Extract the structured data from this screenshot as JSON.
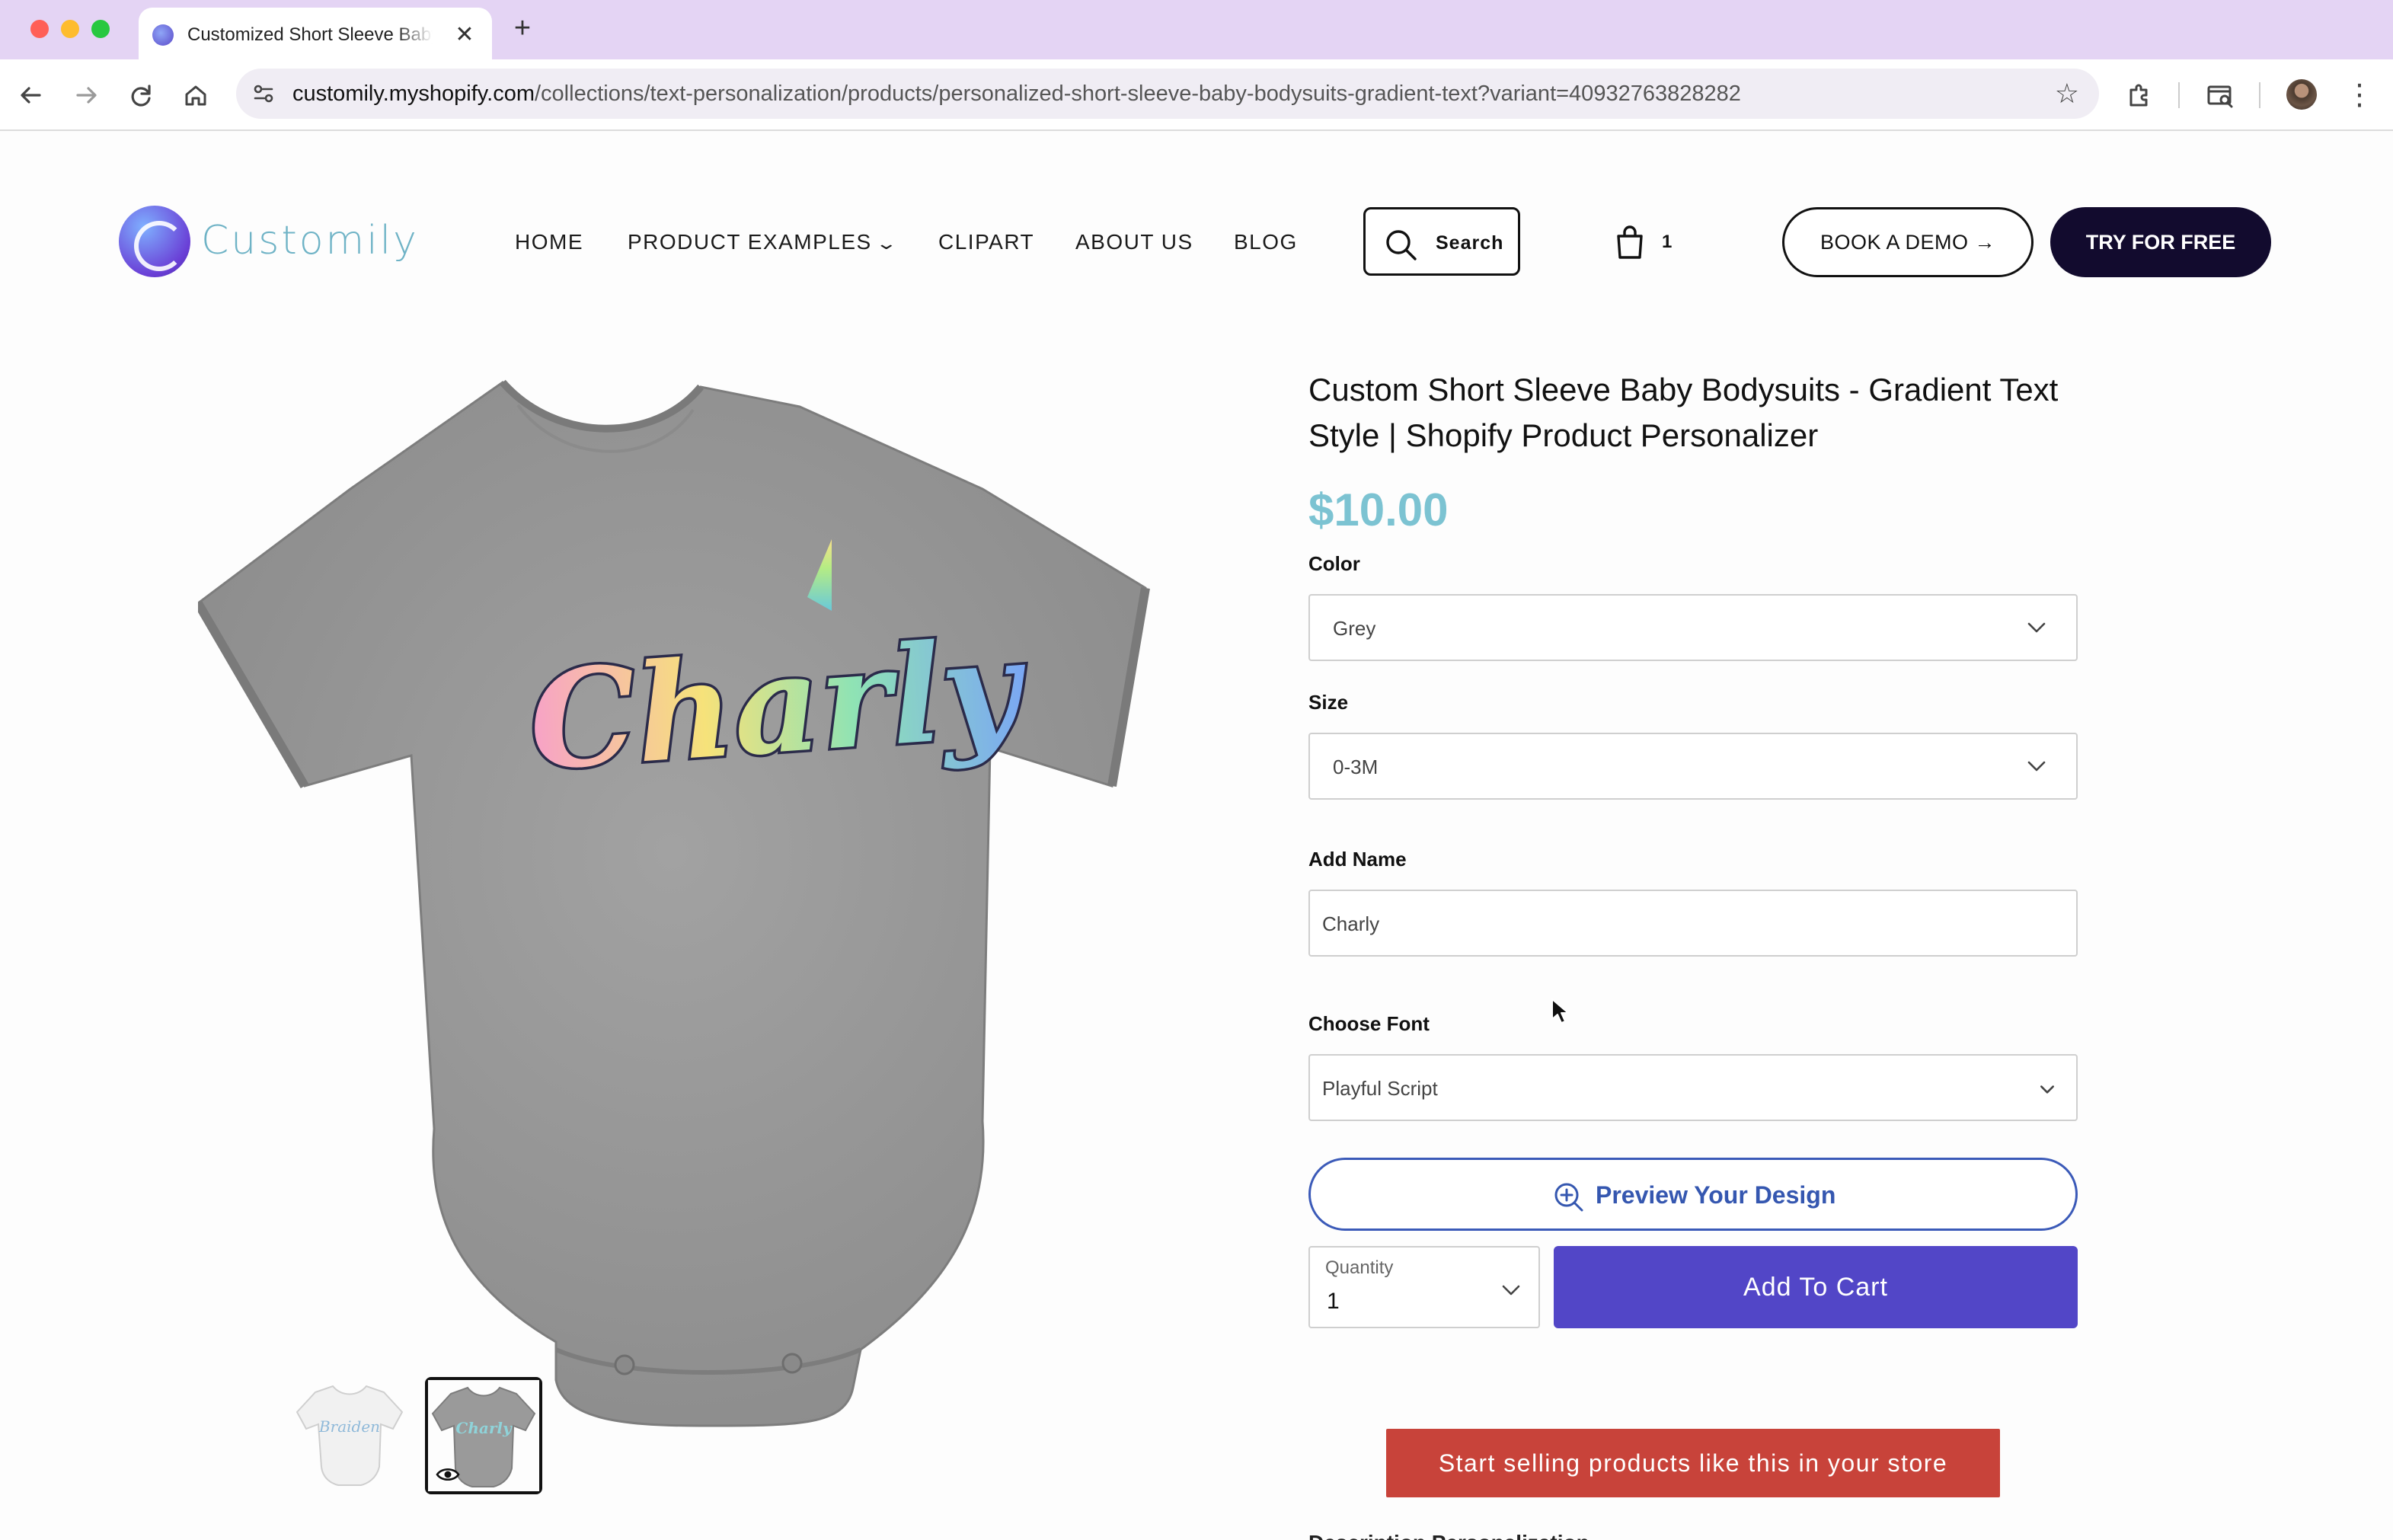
{
  "browser": {
    "tab_title": "Customized Short Sleeve Baby Bodysuits - Gradient Text Style",
    "tab_close": "✕",
    "new_tab": "+",
    "url_host": "customily.myshopify.com",
    "url_path": "/collections/text-personalization/products/personalized-short-sleeve-baby-bodysuits-gradient-text?variant=40932763828282"
  },
  "header": {
    "logo_text": "Customily",
    "nav": {
      "home": "HOME",
      "product_examples": "PRODUCT EXAMPLES",
      "clipart": "CLIPART",
      "about": "ABOUT US",
      "blog": "BLOG"
    },
    "search_label": "Search",
    "cart_count": "1",
    "book_demo": "BOOK A DEMO →",
    "try_free": "TRY FOR FREE"
  },
  "product": {
    "title": "Custom Short Sleeve Baby Bodysuits - Gradient Text Style | Shopify Product Personalizer",
    "price": "$10.00",
    "image_text": "Charly",
    "thumb1_text": "Braiden",
    "thumb2_text": "Charly",
    "color_label": "Color",
    "color_value": "Grey",
    "size_label": "Size",
    "size_value": "0-3M",
    "name_label": "Add Name",
    "name_value": "Charly",
    "font_label": "Choose Font",
    "font_value": "Playful Script",
    "preview_label": "Preview Your Design",
    "quantity_label": "Quantity",
    "quantity_value": "1",
    "add_to_cart": "Add To Cart",
    "sell_cta": "Start selling products like this in your store",
    "description_cutoff": "Description  Personalization"
  },
  "colors": {
    "accent": "#5246c7",
    "price": "#7cc3d2",
    "cta": "#c8433a",
    "dark_button": "#120b2e",
    "tabbar": "#e4d4f4"
  }
}
